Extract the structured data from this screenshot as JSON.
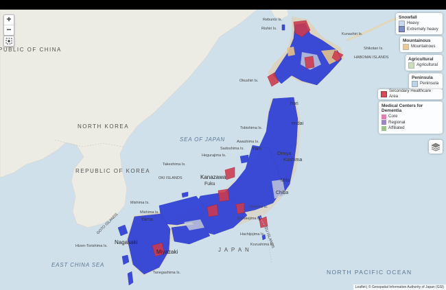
{
  "map": {
    "zoom_in": "+",
    "zoom_out": "−",
    "attribution": "Leaflet | © Geospatial Information Authority of Japan (GSI)",
    "labels": {
      "china": "PUBLIC OF CHINA",
      "north_korea": "NORTH KOREA",
      "south_korea": "REPUBLIC OF KOREA",
      "sea_of_japan": "SEA OF JAPAN",
      "east_china_sea": "EAST CHINA SEA",
      "north_pacific": "NORTH PACIFIC OCEAN",
      "japan": "J A P A N",
      "rebunto": "Rebunto Is.",
      "rishiri": "Rishiri Is.",
      "kunashir": "Kunashiri Is.",
      "shikotan": "Shikotan Is.",
      "habomai": "HABOMAI ISLANDS",
      "okushiri": "Okushiri Is.",
      "tobishima": "Tobishima Is.",
      "awashima": "Awashima Is.",
      "sadoshima": "Sadoshima Is.",
      "hegurajima": "Hegurajima Is.",
      "takeshima": "Takeshima Is.",
      "oki": "OKI ISLANDS",
      "mishima": "Mishima Is.",
      "mishima2": "Mishima Is.",
      "goto": "GOTO ISLANDS",
      "hizen": "Hizen-Torishima Is.",
      "tanegashima": "Tanegashima Is.",
      "oshima": "Oshima Is.",
      "miyakejima": "Miyakejima Is.",
      "hachijojima": "Hachijojima Is.",
      "izu": "IZU ISLANDS",
      "kozushima": "Kozushima Is.",
      "yam": "Yam",
      "fuku": "Fuku",
      "kanazawa": "Kanazawa",
      "yama": "Yama",
      "nagasaki": "Nagasaki",
      "miyazaki": "Miyazaki",
      "kushima": "Kushima",
      "mito": "Mito",
      "chiba": "Chiba",
      "omiya": "Omiya",
      "sendai": "endai",
      "hori": "hori"
    }
  },
  "legend": {
    "snowfall": {
      "title": "Snowfall",
      "items": [
        {
          "label": "Heavy",
          "color": "#c8d8ee"
        },
        {
          "label": "Extremely heavy",
          "color": "#7e8cc8"
        }
      ]
    },
    "mountainous": {
      "title": "Mountainous",
      "items": [
        {
          "label": "Mountainous",
          "color": "#e9c99a"
        }
      ]
    },
    "agricultural": {
      "title": "Agricultural",
      "items": [
        {
          "label": "Agricultural",
          "color": "#cfdcc0"
        }
      ]
    },
    "peninsula": {
      "title": "Peninsula",
      "items": [
        {
          "label": "Peninsula",
          "color": "#bcd4e8"
        }
      ]
    },
    "secondary": {
      "items": [
        {
          "label": "Secondary Healthcare Area",
          "color": "#d24d57"
        }
      ]
    },
    "dementia": {
      "title": "Medical Centers for Dementia",
      "items": [
        {
          "label": "Core",
          "color": "#e07fb0"
        },
        {
          "label": "Regional",
          "color": "#9b87c9"
        },
        {
          "label": "Affiliated",
          "color": "#9fc18b"
        }
      ]
    }
  },
  "colors": {
    "sea": "#cfe0ea",
    "land": "#ecebe4",
    "overlay_blue": "#2e3fd6",
    "overlay_red": "#cc3a4e"
  }
}
